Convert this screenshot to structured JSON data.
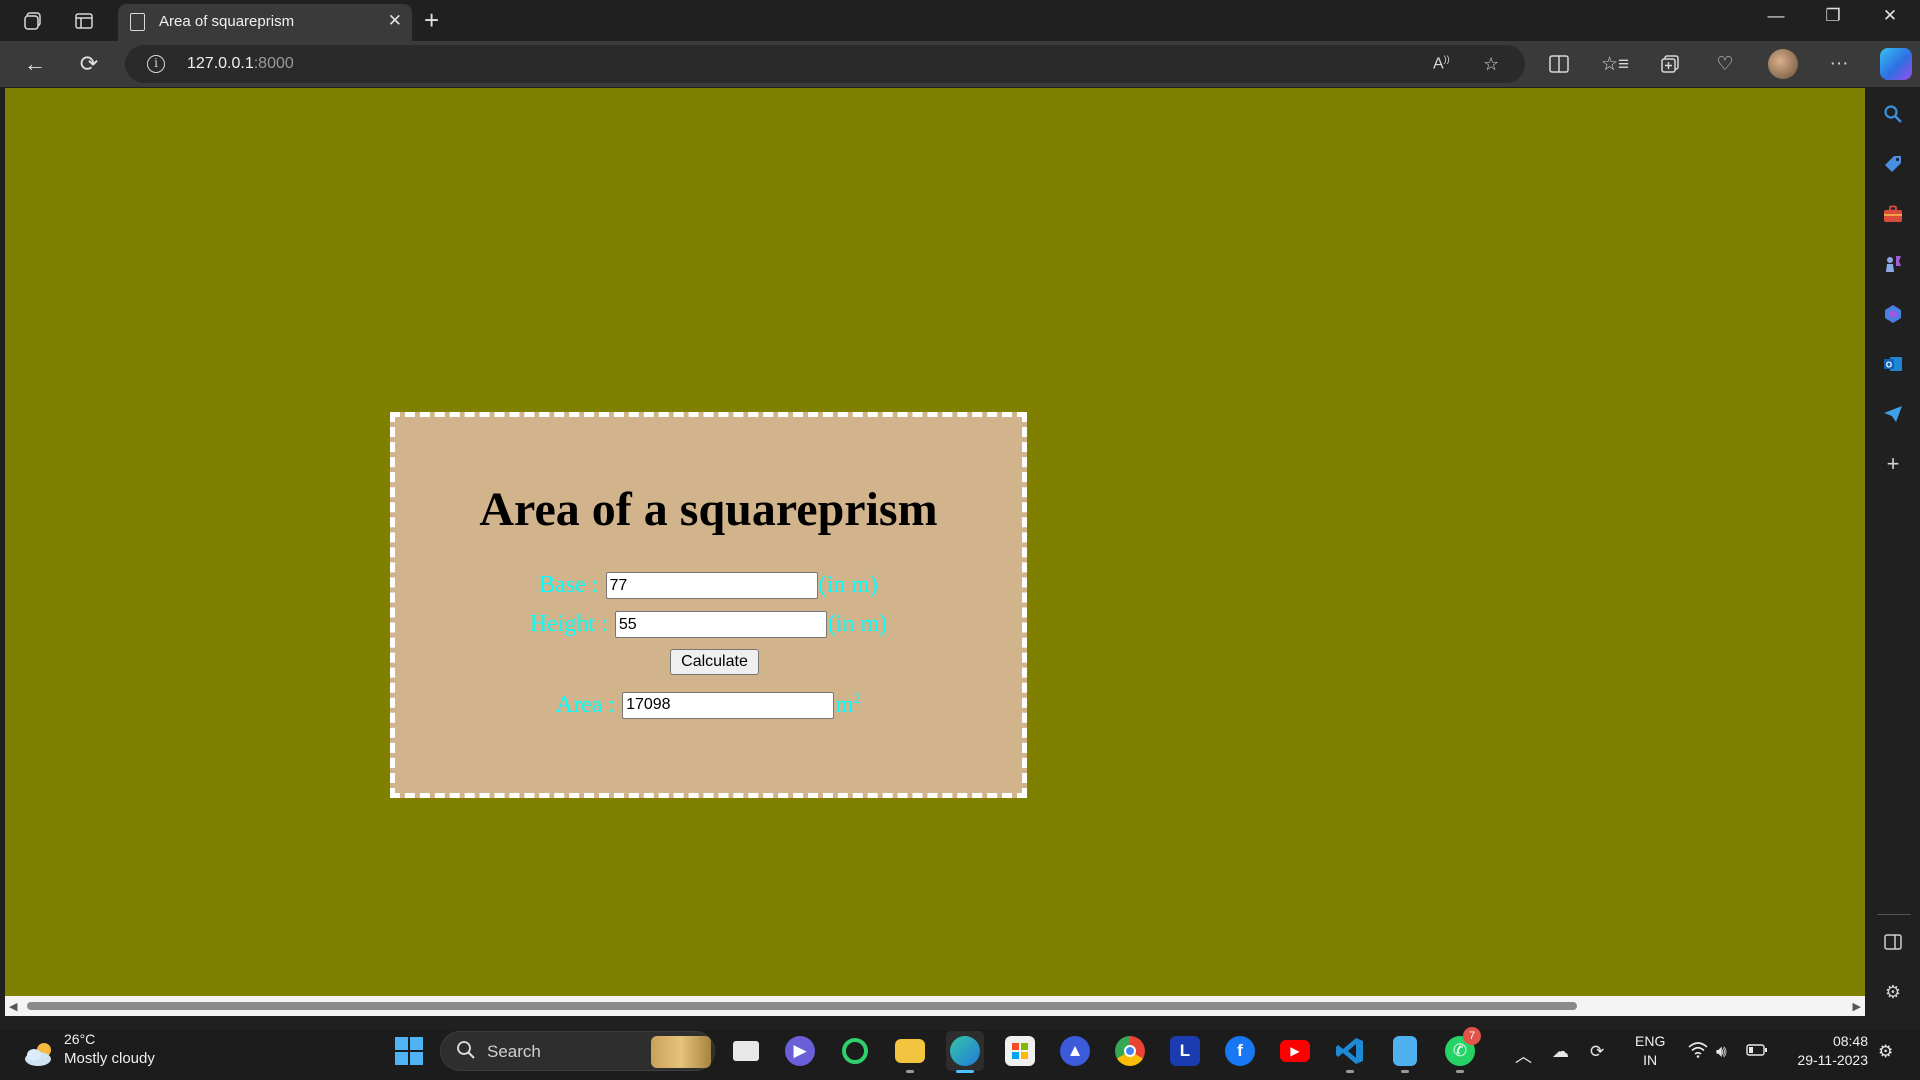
{
  "browser": {
    "tab_title": "Area of squareprism",
    "url_host": "127.0.0.1",
    "url_port": ":8000"
  },
  "page": {
    "heading": "Area of a squareprism",
    "base_label": "Base :",
    "base_value": "77",
    "base_unit": "(in m)",
    "height_label": "Height :",
    "height_value": "55",
    "height_unit": "(in m)",
    "calculate_label": "Calculate",
    "area_label": "Area :",
    "area_value": "17098",
    "area_unit": "m",
    "area_unit_exponent": "2",
    "colors": {
      "background": "#808000",
      "card": "#d2b48c",
      "label": "#00ffff"
    }
  },
  "taskbar": {
    "weather_temp": "26°C",
    "weather_condition": "Mostly cloudy",
    "search_label": "Search",
    "whatsapp_badge": "7",
    "lang_primary": "ENG",
    "lang_region": "IN",
    "time": "08:48",
    "date": "29-11-2023",
    "apps": [
      "task-view",
      "meet-now",
      "refresh-app",
      "file-explorer",
      "edge",
      "microsoft-store",
      "ai-app",
      "chrome",
      "l-app",
      "facebook",
      "youtube",
      "vscode",
      "notepad",
      "whatsapp"
    ]
  }
}
